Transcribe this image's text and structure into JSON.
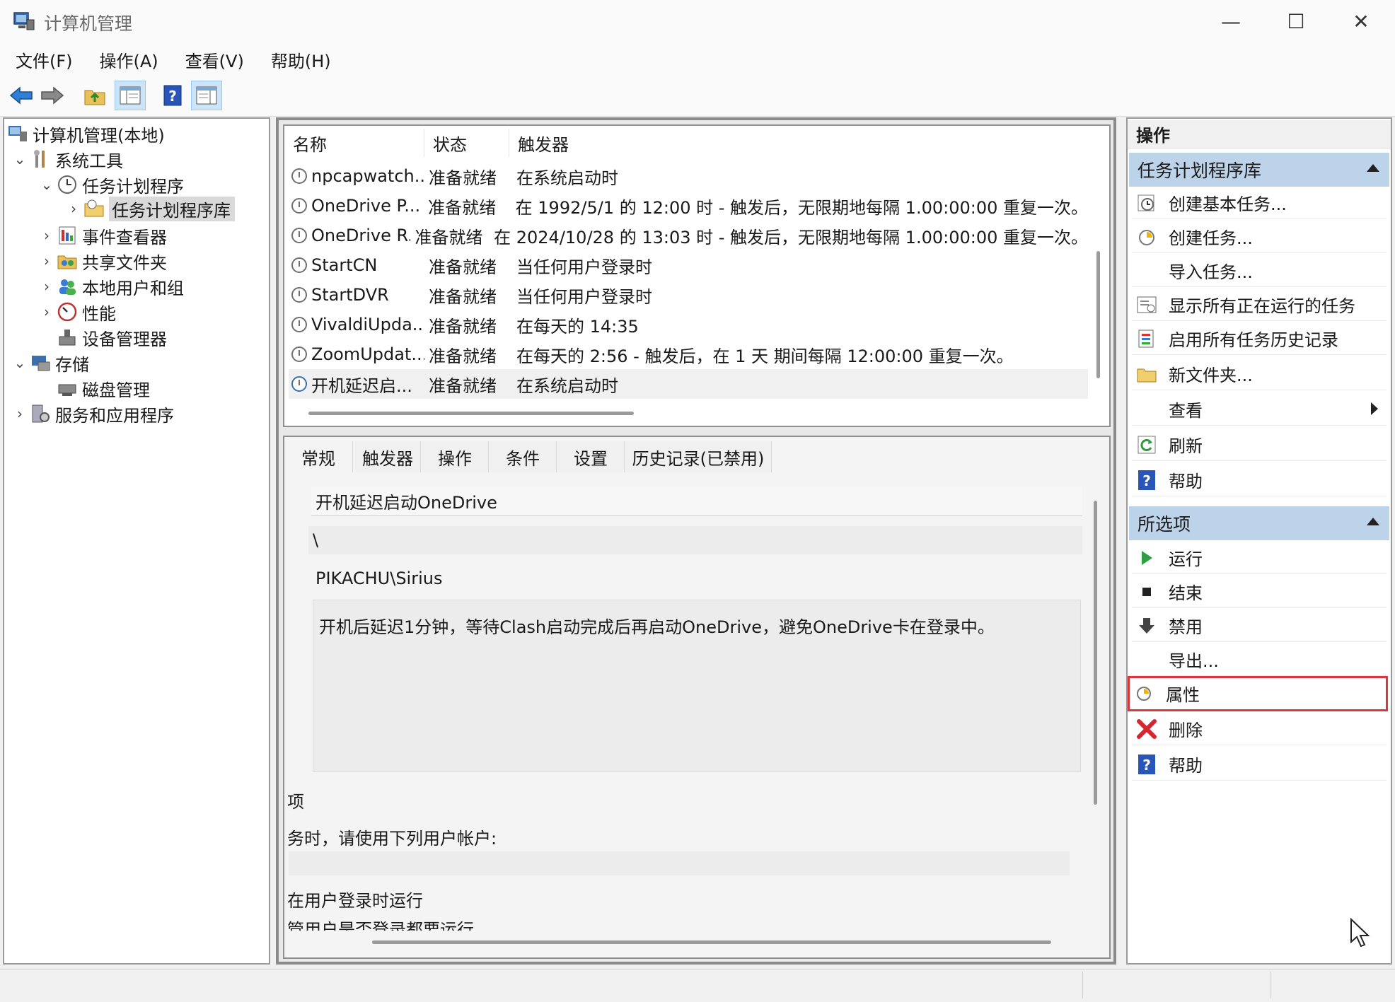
{
  "window": {
    "title": "计算机管理",
    "minimize": "—",
    "maximize": "☐",
    "close": "✕"
  },
  "menu": [
    "文件(F)",
    "操作(A)",
    "查看(V)",
    "帮助(H)"
  ],
  "tree": {
    "root": "计算机管理(本地)",
    "system_tools": "系统工具",
    "task_scheduler": "任务计划程序",
    "task_library": "任务计划程序库",
    "event_viewer": "事件查看器",
    "shared_folders": "共享文件夹",
    "local_users": "本地用户和组",
    "performance": "性能",
    "device_manager": "设备管理器",
    "storage": "存储",
    "disk_management": "磁盘管理",
    "services": "服务和应用程序"
  },
  "task_list": {
    "columns": [
      "名称",
      "状态",
      "触发器"
    ],
    "rows": [
      {
        "name": "npcapwatch...",
        "status": "准备就绪",
        "trigger": "在系统启动时"
      },
      {
        "name": "OneDrive P...",
        "status": "准备就绪",
        "trigger": "在 1992/5/1 的 12:00 时 - 触发后，无限期地每隔 1.00:00:00 重复一次。"
      },
      {
        "name": "OneDrive R...",
        "status": "准备就绪",
        "trigger": "在 2024/10/28 的 13:03 时 - 触发后，无限期地每隔 1.00:00:00 重复一次。"
      },
      {
        "name": "StartCN",
        "status": "准备就绪",
        "trigger": "当任何用户登录时"
      },
      {
        "name": "StartDVR",
        "status": "准备就绪",
        "trigger": "当任何用户登录时"
      },
      {
        "name": "VivaldiUpda...",
        "status": "准备就绪",
        "trigger": "在每天的 14:35"
      },
      {
        "name": "ZoomUpdat...",
        "status": "准备就绪",
        "trigger": "在每天的 2:56 - 触发后，在 1 天 期间每隔 12:00:00 重复一次。"
      },
      {
        "name": "开机延迟启...",
        "status": "准备就绪",
        "trigger": "在系统启动时"
      }
    ]
  },
  "detail": {
    "tabs": [
      "常规",
      "触发器",
      "操作",
      "条件",
      "设置",
      "历史记录(已禁用)"
    ],
    "task_name": "开机延迟启动OneDrive",
    "location": "\\",
    "author": "PIKACHU\\Sirius",
    "description": "开机后延迟1分钟，等待Clash启动完成后再启动OneDrive，避免OneDrive卡在登录中。",
    "security_options": "项",
    "run_as_label": "务时，请使用下列用户帐户:",
    "run_when_logged_on": "在用户登录时运行",
    "run_whether": "管用户是否登录都要运行"
  },
  "actions": {
    "header": "操作",
    "section1": "任务计划程序库",
    "items1": [
      "创建基本任务...",
      "创建任务...",
      "导入任务...",
      "显示所有正在运行的任务",
      "启用所有任务历史记录",
      "新文件夹...",
      "查看",
      "刷新",
      "帮助"
    ],
    "section2": "所选项",
    "items2": [
      "运行",
      "结束",
      "禁用",
      "导出...",
      "属性",
      "删除",
      "帮助"
    ]
  },
  "colors": {
    "section_bg": "#bcd3ea",
    "highlight_border": "#d9363e",
    "selection": "#d9d9d9"
  }
}
